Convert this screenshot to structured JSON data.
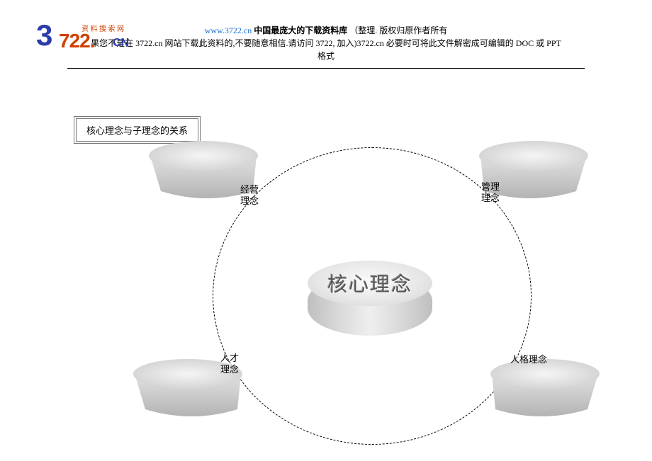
{
  "header": {
    "url": "www.3722.cn",
    "slogan": "中国最庞大的下载资料库",
    "note1": "（整理.  版权归原作者所有",
    "line2_a": "果您不是在 3722.cn 网站下载此资料的,不要随意相信.请访问 3722,  加入)3722.cn 必要时可将此文件解密成可编辑的 DOC 或 PPT",
    "line3": "格式"
  },
  "logo": {
    "tag": "资 料 搜 索 网",
    "a": "3",
    "b": "722.",
    "c": "CN"
  },
  "title_box": "核心理念与子理念的关系",
  "core_label": "核心理念",
  "nodes": {
    "tl": "经营\n理念",
    "tr": "管理\n理念",
    "bl": "人才\n理念",
    "br": "人格理念"
  }
}
